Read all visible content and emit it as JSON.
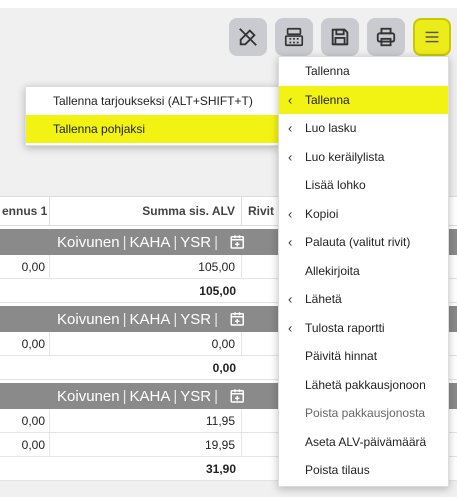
{
  "toolbar": {
    "buttons": [
      {
        "name": "edit-off-button",
        "icon": "edit-off-icon"
      },
      {
        "name": "calculator-button",
        "icon": "calculator-icon"
      },
      {
        "name": "save-button",
        "icon": "save-icon"
      },
      {
        "name": "print-button",
        "icon": "printer-icon"
      },
      {
        "name": "menu-button",
        "icon": "hamburger-icon",
        "active": true
      }
    ],
    "accent": "#ecec1a"
  },
  "grid": {
    "headers": {
      "col1": "ennus 1",
      "col2": "Summa sis. ALV",
      "col3": "Rivit"
    },
    "group_label": {
      "name": "Koivunen",
      "code1": "KAHA",
      "code2": "YSR",
      "sep": "|"
    },
    "groups": [
      {
        "rows": [
          {
            "col1": "0,00",
            "col2": "105,00"
          }
        ],
        "sum": "105,00"
      },
      {
        "rows": [
          {
            "col1": "0,00",
            "col2": "0,00"
          }
        ],
        "sum": "0,00"
      },
      {
        "rows": [
          {
            "col1": "0,00",
            "col2": "11,95"
          },
          {
            "col1": "0,00",
            "col2": "19,95"
          }
        ],
        "sum": "31,90"
      }
    ]
  },
  "submenu": {
    "items": [
      {
        "label": "Tallenna tarjoukseksi (ALT+SHIFT+T)"
      },
      {
        "label": "Tallenna pohjaksi",
        "highlighted": true
      }
    ]
  },
  "menu": {
    "items": [
      {
        "label": "Tallenna",
        "chevron": false
      },
      {
        "label": "Tallenna",
        "chevron": true,
        "highlighted": true
      },
      {
        "label": "Luo lasku",
        "chevron": true
      },
      {
        "label": "Luo keräilylista",
        "chevron": true
      },
      {
        "label": "Lisää lohko",
        "chevron": false
      },
      {
        "label": "Kopioi",
        "chevron": true
      },
      {
        "label": "Palauta (valitut rivit)",
        "chevron": true
      },
      {
        "label": "Allekirjoita",
        "chevron": false
      },
      {
        "label": "Lähetä",
        "chevron": true
      },
      {
        "label": "Tulosta raportti",
        "chevron": true
      },
      {
        "label": "Päivitä hinnat",
        "chevron": false
      },
      {
        "label": "Lähetä pakkausjonoon",
        "chevron": false
      },
      {
        "label": "Poista pakkausjonosta",
        "chevron": false,
        "dim": true
      },
      {
        "label": "Aseta ALV-päivämäärä",
        "chevron": false
      },
      {
        "label": "Poista tilaus",
        "chevron": false
      }
    ],
    "chevron_glyph": "‹"
  }
}
